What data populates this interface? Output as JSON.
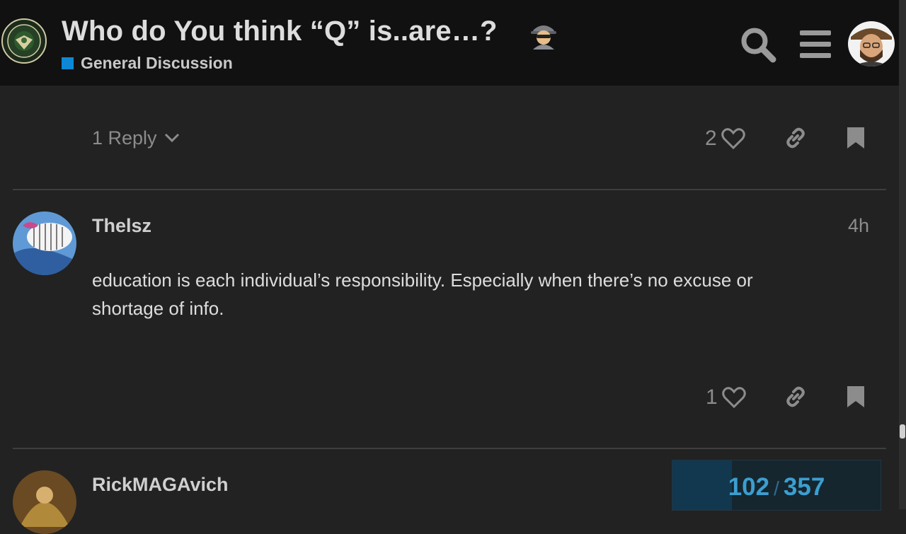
{
  "header": {
    "site_logo": "infowars-army-seal-logo",
    "topic_title": "Who do You think “Q” is..are…?",
    "title_emoji": "spy-emoji",
    "category": {
      "name": "General Discussion",
      "color": "#0e88d6"
    },
    "search_icon": "search-icon",
    "menu_icon": "hamburger-menu-icon",
    "user_avatar": "current-user-avatar"
  },
  "posts": [
    {
      "replies_label": "1 Reply",
      "like_count": "2"
    },
    {
      "username": "Thelsz",
      "age": "4h",
      "body": "education is each individual’s responsibility. Especially when there’s no excuse or shortage of info.",
      "like_count": "1"
    },
    {
      "username": "RickMAGAvich"
    }
  ],
  "progress": {
    "current": "102",
    "separator": "/",
    "total": "357",
    "fraction": 0.2857
  },
  "colors": {
    "background": "#222222",
    "header": "#111111",
    "accent": "#3c9ed0"
  }
}
